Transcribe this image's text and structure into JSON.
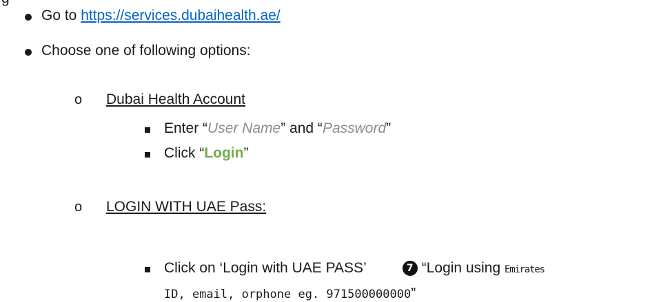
{
  "top_fragment": "g",
  "step1": {
    "prefix": "Go to ",
    "link": "https://services.dubaihealth.ae/"
  },
  "step2": {
    "text": "Choose one of following options:"
  },
  "option1": {
    "marker": "o",
    "title": "Dubai Health Account",
    "sub1": {
      "part1": "Enter “",
      "user_name": "User Name",
      "part2": "” and “",
      "password": "Password",
      "part3": "”"
    },
    "sub2": {
      "part1": "Click “",
      "login": "Login",
      "part2": "”"
    }
  },
  "option2": {
    "marker": "o",
    "title": "LOGIN WITH UAE Pass:",
    "sub1": {
      "text": "Click on ‘Login with UAE PASS’",
      "badge": "7",
      "quote_open": "“Login using ",
      "emirates": "Emirates",
      "line2": "ID, email, orphone eg. 971500000000",
      "quote_close": "”"
    }
  }
}
